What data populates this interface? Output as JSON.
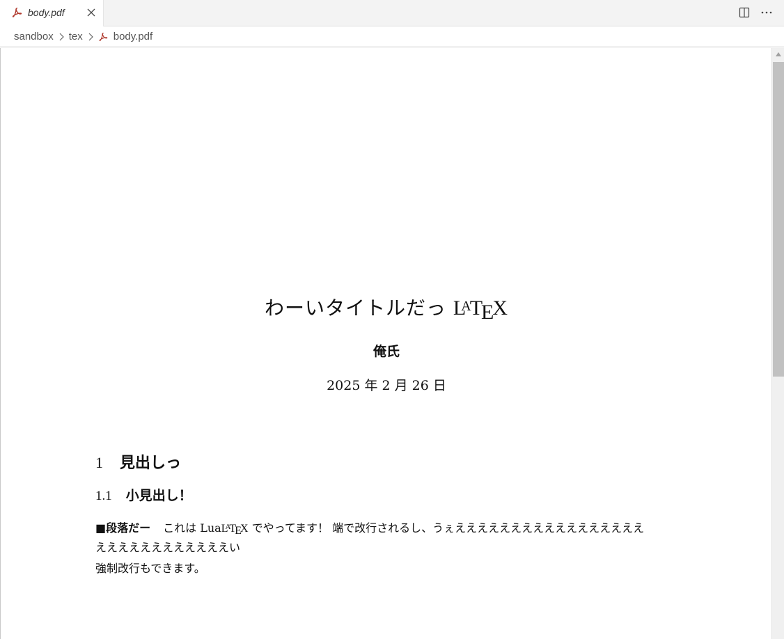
{
  "tab": {
    "label": "body.pdf",
    "pdf_icon": "pdf-icon",
    "close_icon": "close-icon"
  },
  "toolbar": {
    "split_icon": "split-editor-icon",
    "more_icon": "more-actions-icon"
  },
  "breadcrumb": {
    "items": [
      "sandbox",
      "tex",
      "body.pdf"
    ]
  },
  "document": {
    "title_text": "わーいタイトルだっ",
    "title_logo": {
      "L": "L",
      "A": "A",
      "T": "T",
      "E": "E",
      "X": "X"
    },
    "author": "俺氏",
    "date": "2025 年 2 月 26 日",
    "section": {
      "number": "1",
      "title": "見出しっ"
    },
    "subsection": {
      "number": "1.1",
      "title": "小見出し！"
    },
    "paragraph": {
      "heading": "■段落だー",
      "text_before_logo": "これは Lua",
      "text_after_logo": " でやってます！ 端で改行されるし、うぇえええええええええええええええええ",
      "line2": "ええええええええええええい",
      "line3": "強制改行もできます。"
    }
  },
  "colors": {
    "tabbar_bg": "#f3f3f3",
    "scrollbar_thumb": "#c1c1c1",
    "pdf_icon": "#c0392b"
  }
}
